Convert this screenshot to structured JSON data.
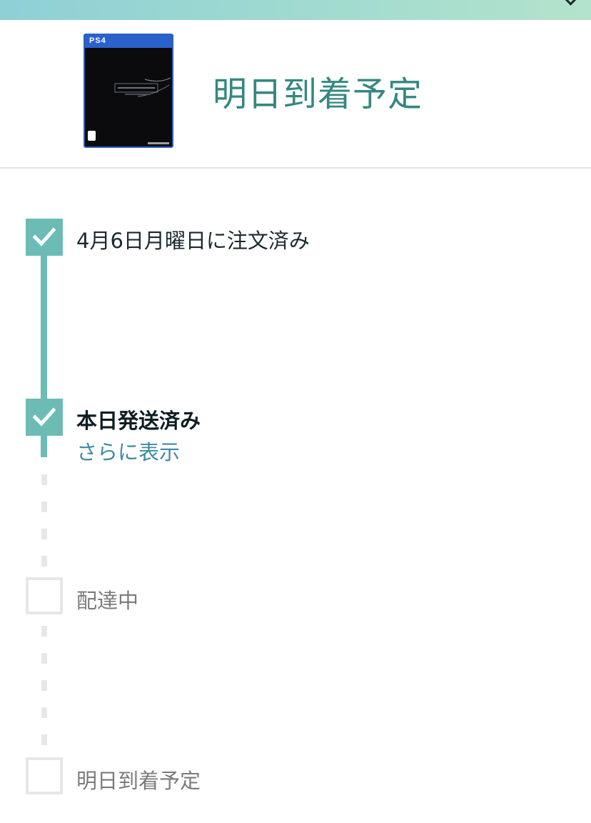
{
  "header": {
    "title": "明日到着予定",
    "product_image": {
      "platform_logo": "PS4",
      "accent_color": "#2a62cc"
    }
  },
  "colors": {
    "accent": "#6cbcb5",
    "title": "#34887f",
    "link": "#3f8aa0",
    "pending": "#e7e7e7"
  },
  "timeline": {
    "steps": [
      {
        "label": "4月6日月曜日に注文済み",
        "status": "done",
        "icon": "check-icon"
      },
      {
        "label": "本日発送済み",
        "status": "current",
        "icon": "check-icon"
      },
      {
        "label": "配達中",
        "status": "pending",
        "icon": "empty-box"
      },
      {
        "label": "明日到着予定",
        "status": "pending",
        "icon": "empty-box"
      }
    ],
    "more_link": "さらに表示"
  }
}
